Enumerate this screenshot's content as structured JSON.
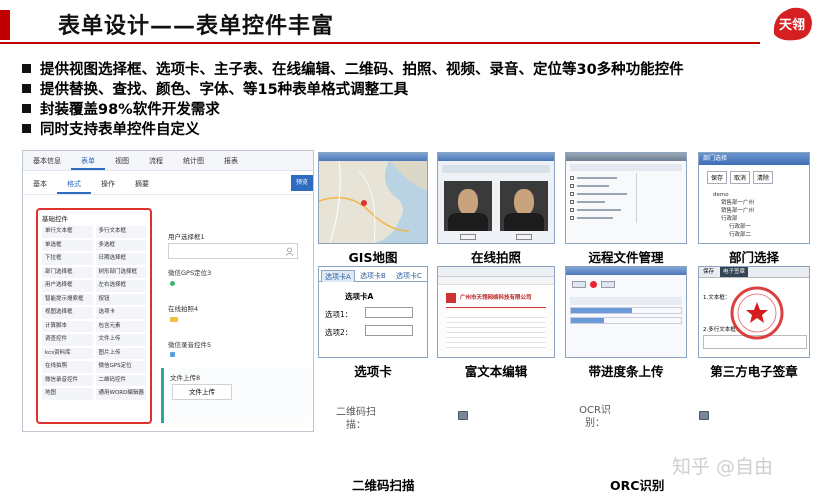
{
  "header": {
    "title": "表单设计——表单控件丰富",
    "logo_text": "天翎"
  },
  "bullets": [
    "提供视图选择框、选项卡、主子表、在线编辑、二维码、拍照、视频、录音、定位等30多种功能控件",
    "提供替换、查找、颜色、字体、等15种表单格式调整工具",
    "封装覆盖98%软件开发需求",
    "同时支持表单控件自定义"
  ],
  "designer": {
    "top_tabs": [
      "基本信息",
      "表单",
      "视图",
      "流程",
      "统计图",
      "报表"
    ],
    "sub_tabs": [
      "基本",
      "格式",
      "操作",
      "摘要"
    ],
    "corner_button": "预览",
    "component_header": "基础控件",
    "components": [
      "单行文本框",
      "多行文本框",
      "单选框",
      "多选框",
      "下拉框",
      "日期选择框",
      "部门选择框",
      "树形部门选择框",
      "用户选择框",
      "左右选择框",
      "智能提示搜索框",
      "按钮",
      "视图选择框",
      "选项卡",
      "计算脚本",
      "包含元素",
      "调查控件",
      "文件上传",
      "kcs资料库",
      "图片上传",
      "在线拍照",
      "微信GPS定位",
      "微信录音控件",
      "二维码控件",
      "地图",
      "通用WORD编辑器"
    ],
    "fields": {
      "user_select": "用户选择框1",
      "gps": "微信GPS定位3",
      "photo": "在线拍照4",
      "voice": "微信录音控件5",
      "file_upload": "文件上传8",
      "upload_button": "文件上传"
    }
  },
  "thumbnails": {
    "gis": "GIS地图",
    "photo": "在线拍照",
    "remote_file": "远程文件管理",
    "dept": "部门选择",
    "tabs": "选项卡",
    "rich_text": "富文本编辑",
    "progress": "带进度条上传",
    "signature": "第三方电子签章"
  },
  "tabs_sample": {
    "tab_names": [
      "选项卡A",
      "选项卡B",
      "选项卡C"
    ],
    "heading": "选项卡A",
    "option1": "选项1：",
    "option2": "选项2："
  },
  "dept_sample": {
    "header": "部门选择",
    "btn_save": "保存",
    "btn_cancel": "取消",
    "btn_clear": "清除",
    "tree": [
      "demo",
      "销售部一广州",
      "销售部一广州",
      "行政部",
      "行政部一",
      "行政部二"
    ]
  },
  "rich_sample": {
    "company": "广州市天翎网络科技有限公司"
  },
  "sign_sample": {
    "header_btn": "保存",
    "header_tab": "电子签章",
    "row1": "1.文本框：",
    "row2": "2.多行文本框："
  },
  "bottom": {
    "qr_label": "二维码扫描：",
    "ocr_label": "OCR识别：",
    "qr_caption": "二维码扫描",
    "ocr_caption": "ORC识别"
  },
  "watermark": "知乎 @自由",
  "colors": {
    "accent_red": "#c00000",
    "designer_blue": "#2d6cc0",
    "highlight_red": "#e03030",
    "teal": "#2aa89a"
  }
}
